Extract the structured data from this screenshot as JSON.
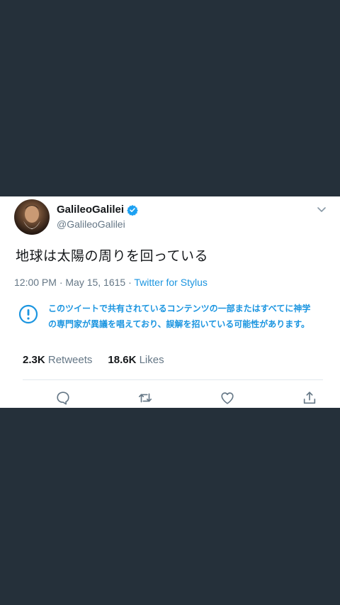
{
  "tweet": {
    "display_name": "GalileoGalilei",
    "handle": "@GalileoGalilei",
    "text": "地球は太陽の周りを回っている",
    "time_date": "12:00 PM · May 15, 1615 · ",
    "source": "Twitter for Stylus",
    "notice_line1": "このツイートで共有されているコンテンツの一部またはすべてに神学",
    "notice_line2": "の専門家が異議を唱えており、誤解を招いている可能性があります。",
    "retweets_count": "2.3K",
    "retweets_label": "Retweets",
    "likes_count": "18.6K",
    "likes_label": "Likes"
  },
  "colors": {
    "background": "#25303a",
    "card": "#ffffff",
    "accent": "#1b95e0",
    "muted": "#657786"
  },
  "icons": [
    "verified-badge-icon",
    "chevron-down-icon",
    "alert-circle-icon",
    "reply-icon",
    "retweet-icon",
    "like-icon",
    "share-icon"
  ]
}
